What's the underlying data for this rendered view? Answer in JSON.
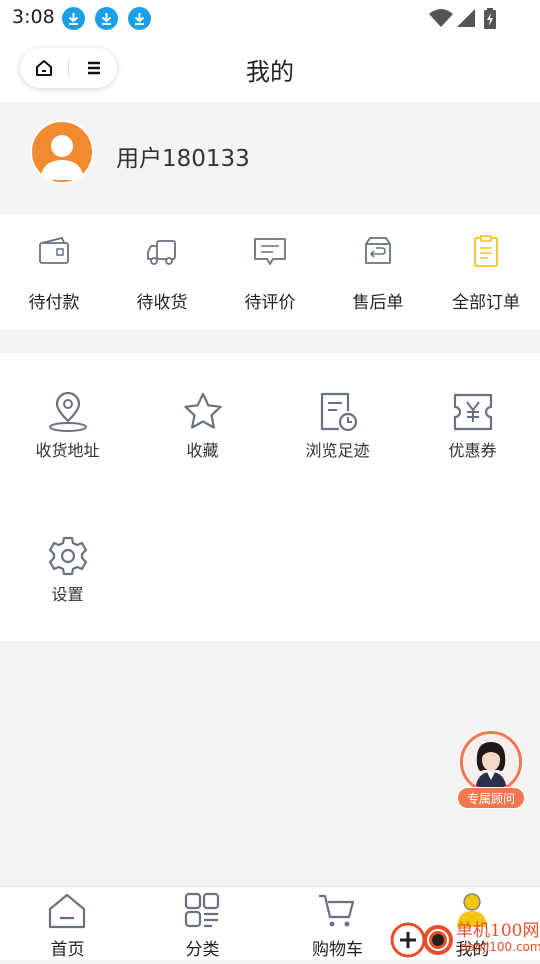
{
  "status_bar": {
    "time": "3:08"
  },
  "header": {
    "title": "我的"
  },
  "profile": {
    "username": "用户180133"
  },
  "orders": [
    {
      "label": "待付款",
      "icon": "wallet-icon"
    },
    {
      "label": "待收货",
      "icon": "truck-icon"
    },
    {
      "label": "待评价",
      "icon": "comment-icon"
    },
    {
      "label": "售后单",
      "icon": "return-icon"
    },
    {
      "label": "全部订单",
      "icon": "order-list-icon"
    }
  ],
  "tools": [
    {
      "label": "收货地址",
      "icon": "location-icon"
    },
    {
      "label": "收藏",
      "icon": "star-icon"
    },
    {
      "label": "浏览足迹",
      "icon": "history-icon"
    },
    {
      "label": "优惠券",
      "icon": "coupon-icon"
    },
    {
      "label": "设置",
      "icon": "gear-icon"
    }
  ],
  "advisor": {
    "label": "专属顾问"
  },
  "tabbar": [
    {
      "label": "首页",
      "icon": "home-icon"
    },
    {
      "label": "分类",
      "icon": "category-icon"
    },
    {
      "label": "购物车",
      "icon": "cart-icon"
    },
    {
      "label": "我的",
      "icon": "profile-icon"
    }
  ],
  "watermark": {
    "text": "单机100网",
    "url": "danji100.com"
  },
  "colors": {
    "accent": "#f28a30",
    "icon_gray": "#6b7080",
    "order_highlight": "#f5c518",
    "advisor": "#f07850"
  }
}
